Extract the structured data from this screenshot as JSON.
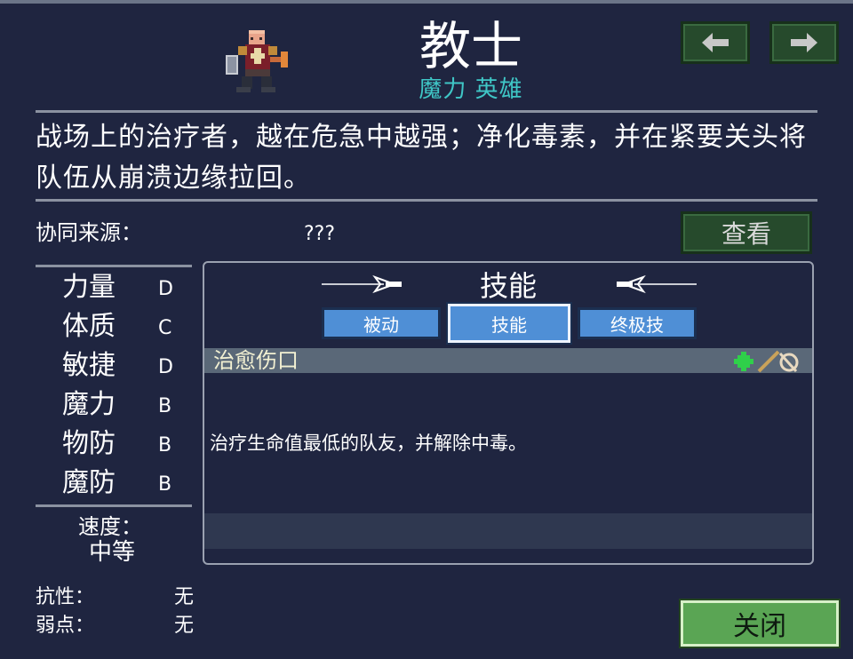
{
  "hero": {
    "name": "教士",
    "subtitle": "魔力 英雄",
    "description": "战场上的治疗者，越在危急中越强；净化毒素，并在紧要关头将队伍从崩溃边缘拉回。"
  },
  "nav": {
    "prev_icon": "arrow-left-icon",
    "prev_glyph": "🡐",
    "next_icon": "arrow-right-icon",
    "next_glyph": "🡒"
  },
  "synergy": {
    "label": "协同来源：",
    "value": "???",
    "view_button": "查看"
  },
  "stats": [
    {
      "name": "力量",
      "grade": "D"
    },
    {
      "name": "体质",
      "grade": "C"
    },
    {
      "name": "敏捷",
      "grade": "D"
    },
    {
      "name": "魔力",
      "grade": "B"
    },
    {
      "name": "物防",
      "grade": "B"
    },
    {
      "name": "魔防",
      "grade": "B"
    }
  ],
  "speed": {
    "label": "速度：",
    "value": "中等"
  },
  "resistance": {
    "label": "抗性：",
    "value": "无"
  },
  "weakness": {
    "label": "弱点：",
    "value": "无"
  },
  "skills_panel": {
    "title": "技能",
    "tabs": [
      {
        "label": "被动",
        "active": false
      },
      {
        "label": "技能",
        "active": true
      },
      {
        "label": "终极技",
        "active": false
      }
    ],
    "skill": {
      "name": "治愈伤口",
      "description": "治疗生命值最低的队友，并解除中毒。",
      "icons": [
        "green-gem-icon",
        "staff-icon"
      ]
    }
  },
  "close_button": "关闭",
  "colors": {
    "background": "#1f2540",
    "subtitle": "#3fc6c6",
    "tab_blue": "#4f8fd6",
    "green_button": "#264a2c",
    "close_green": "#5aa554"
  }
}
